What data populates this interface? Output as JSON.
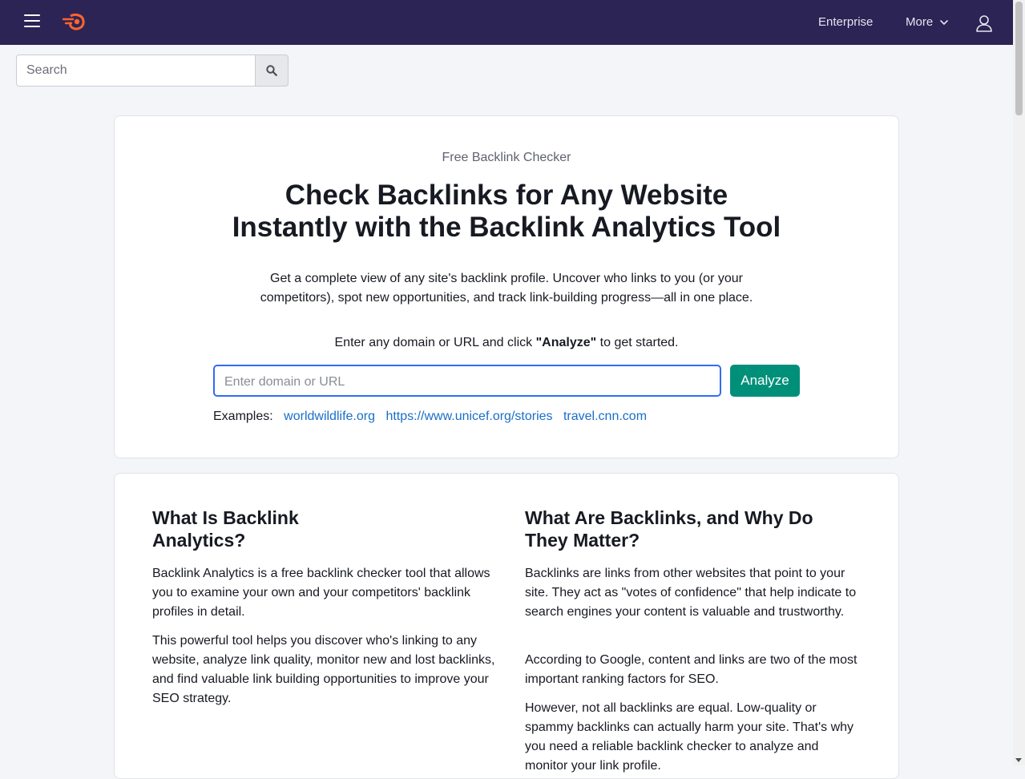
{
  "topbar": {
    "brand_color": "#2c2455",
    "menu_icon": "hamburger-menu-icon",
    "logo": "semrush-logo",
    "nav": {
      "enterprise": "Enterprise",
      "more": "More"
    },
    "user_icon": "user-icon"
  },
  "search": {
    "placeholder": "Search",
    "button_icon": "search-icon"
  },
  "hero": {
    "eyebrow": "Free Backlink Checker",
    "title_line1": "Check Backlinks for Any Website",
    "title_line2": "Instantly with the Backlink Analytics Tool",
    "description": "Get a complete view of any site's backlink profile. Uncover who links to you (or your competitors), spot new opportunities, and track link-building progress—all in one place.",
    "cta_prefix": "Enter any domain or URL and click ",
    "cta_bold": "\"Analyze\"",
    "cta_suffix": " to get started.",
    "input_placeholder": "Enter domain or URL",
    "analyze_label": "Analyze",
    "accent_color": "#00907a",
    "examples_label": "Examples:",
    "examples": [
      "worldwildlife.org",
      "https://www.unicef.org/stories",
      "travel.cnn.com"
    ]
  },
  "info": {
    "left": {
      "heading": "What Is Backlink Analytics?",
      "paragraphs": [
        "Backlink Analytics is a free backlink checker tool that allows you to examine your own and your competitors' backlink profiles in detail.",
        "This powerful tool helps you discover who's linking to any website, analyze link quality, monitor new and lost backlinks, and find valuable link building opportunities to improve your SEO strategy."
      ]
    },
    "right": {
      "heading": "What Are Backlinks, and Why Do They Matter?",
      "paragraphs": [
        "Backlinks are links from other websites that point to your site. They act as \"votes of confidence\" that help indicate to search engines your content is valuable and trustworthy.",
        "According to Google, content and links are two of the most important ranking factors for SEO.",
        "However, not all backlinks are equal. Low-quality or spammy backlinks can actually harm your site. That's why you need a reliable backlink checker to analyze and monitor your link profile."
      ]
    }
  }
}
